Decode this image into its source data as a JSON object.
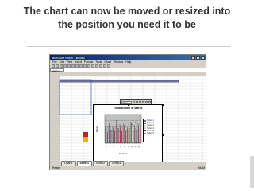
{
  "slide": {
    "title_line1": "The chart can now be moved or resized into",
    "title_line2": "the position you need it to be"
  },
  "app": {
    "window_title": "Microsoft Excel - Book1",
    "menus": [
      "File",
      "Edit",
      "View",
      "Insert",
      "Format",
      "Tools",
      "Chart",
      "Window",
      "Help"
    ],
    "namebox": "Chart 1",
    "sheet_tabs": [
      "Chart1",
      "Sheet1",
      "Sheet2",
      "Sheet3"
    ],
    "active_tab": "Sheet1",
    "status_left": "Ready",
    "status_right": "NUM"
  },
  "chart_toolbar": {
    "field_label": "Chart Area"
  },
  "chart_data": {
    "type": "bar",
    "title": "Distribution of Marks",
    "categories": [
      "1",
      "2",
      "3",
      "4",
      "5",
      "6",
      "7",
      "8",
      "9",
      "10"
    ],
    "series": [
      {
        "name": "Series 1",
        "values": [
          60,
          72,
          55,
          80,
          66,
          70,
          58,
          75,
          62,
          68
        ],
        "color": "#7b6b8f"
      },
      {
        "name": "Series 2",
        "values": [
          45,
          60,
          50,
          65,
          55,
          62,
          48,
          70,
          52,
          58
        ],
        "color": "#a05060"
      },
      {
        "name": "Series 3",
        "values": [
          70,
          55,
          62,
          58,
          72,
          50,
          66,
          60,
          74,
          64
        ],
        "color": "#e8e0b8"
      },
      {
        "name": "Series 4",
        "values": [
          50,
          66,
          44,
          70,
          48,
          60,
          54,
          64,
          46,
          56
        ],
        "color": "#c0d8e8"
      },
      {
        "name": "Series 5",
        "values": [
          38,
          48,
          42,
          52,
          40,
          46,
          36,
          50,
          44,
          42
        ],
        "color": "#6b2040"
      },
      {
        "name": "Series 6",
        "values": [
          55,
          40,
          58,
          45,
          60,
          42,
          52,
          48,
          56,
          50
        ],
        "color": "#f08070"
      }
    ],
    "ylim": [
      0,
      100
    ],
    "xlabel": "Student",
    "ylabel": "Marks",
    "legend": "right"
  },
  "colors": {
    "highlight_row": "#6a6a9a",
    "selection": "#2040a0",
    "swatch_red": "#c02020",
    "swatch_yellow": "#e0b020"
  }
}
